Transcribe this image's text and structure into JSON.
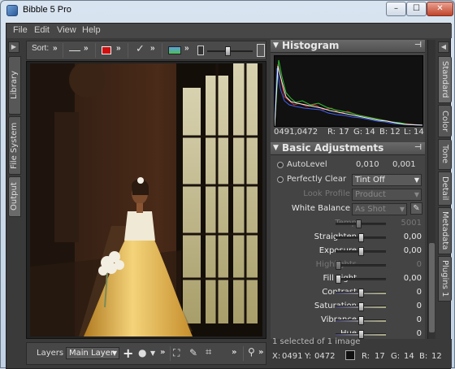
{
  "window": {
    "title": "Bibble 5 Pro",
    "min": "–",
    "max": "☐",
    "close": "✕"
  },
  "menu": [
    "File",
    "Edit",
    "View",
    "Help"
  ],
  "toolbar": {
    "sort_label": "Sort:",
    "more": "»"
  },
  "left_tabs": [
    "Library",
    "File System",
    "Output"
  ],
  "right_tabs": [
    "Standard",
    "Color",
    "Tone",
    "Detail",
    "Metadata",
    "Plugins 1"
  ],
  "histogram": {
    "title": "Histogram",
    "coords": "0491,0472",
    "r_label": "R:",
    "r": "17",
    "g_label": "G:",
    "g": "14",
    "b_label": "B:",
    "b": "12",
    "l_label": "L:",
    "l": "14"
  },
  "basic": {
    "title": "Basic Adjustments",
    "autolevel": {
      "label": "AutoLevel",
      "v1": "0,010",
      "v2": "0,001"
    },
    "perfectly_clear": {
      "label": "Perfectly Clear",
      "value": "Tint Off"
    },
    "look_profile": {
      "label": "Look Profile",
      "value": "Product"
    },
    "white_balance": {
      "label": "White Balance",
      "value": "As Shot"
    },
    "rows": [
      {
        "label": "Temp",
        "value": "5001",
        "level": 0.45,
        "dim": true
      },
      {
        "label": "Straighten",
        "value": "0,00",
        "level": 0.5,
        "dim": false
      },
      {
        "label": "Exposure",
        "value": "0,00",
        "level": 0.5,
        "dim": false
      },
      {
        "label": "Highlights",
        "value": "0",
        "level": 0.0,
        "dim": true
      },
      {
        "label": "Fill Light",
        "value": "0,00",
        "level": 0.0,
        "dim": false
      },
      {
        "label": "Contrast",
        "value": "0",
        "level": 0.5,
        "dim": false
      },
      {
        "label": "Saturation",
        "value": "0",
        "level": 0.5,
        "dim": false
      },
      {
        "label": "Vibrance",
        "value": "0",
        "level": 0.5,
        "dim": false
      },
      {
        "label": "Hue",
        "value": "0",
        "level": 0.5,
        "dim": false
      }
    ]
  },
  "bottom": {
    "layers_label": "Layers",
    "layer_value": "Main Layer",
    "more": "»"
  },
  "status": {
    "selection": "1 selected of 1 image",
    "x_label": "X:",
    "x": "0491",
    "y_label": "Y:",
    "y": "0472",
    "r_label": "R:",
    "r": "17",
    "g_label": "G:",
    "g": "14",
    "b_label": "B:",
    "b": "12"
  }
}
